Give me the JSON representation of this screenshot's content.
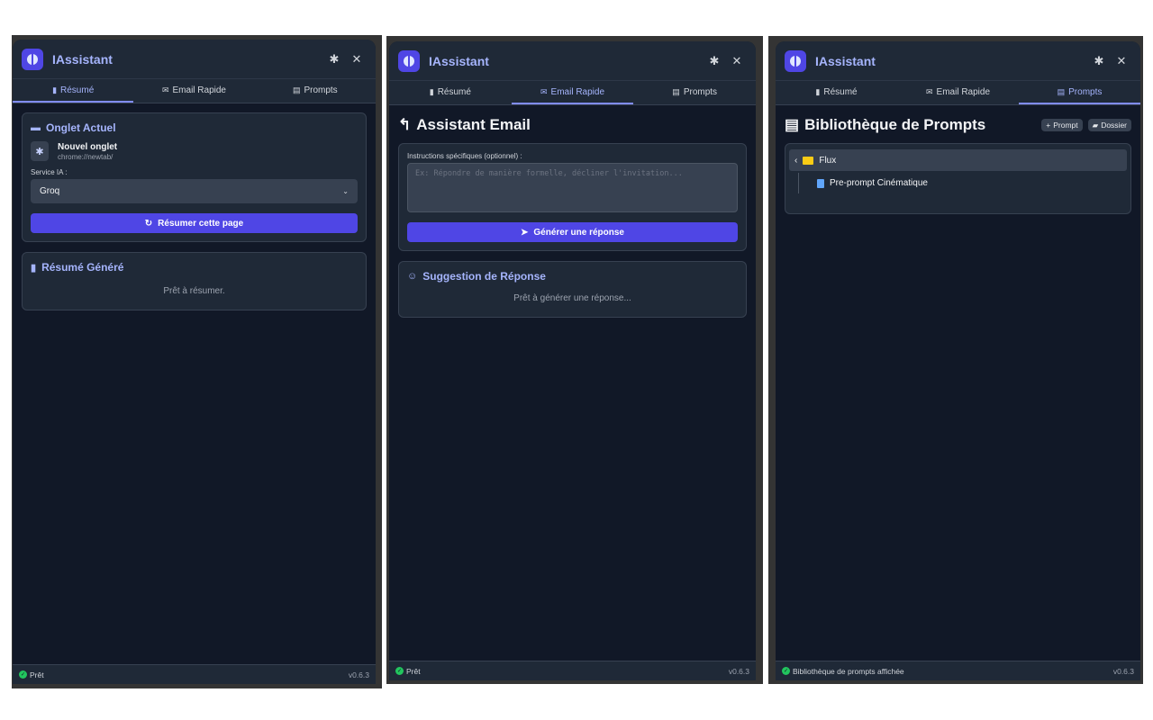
{
  "colors": {
    "accent": "#4f46e5",
    "accent_text": "#a5b4fc",
    "panel_bg": "#111827",
    "card_bg": "#1f2937",
    "status_ok": "#22c55e",
    "folder": "#facc15"
  },
  "common": {
    "app_title": "IAssistant",
    "icons": {
      "logo": "brain-icon",
      "settings": "gear-icon",
      "close": "close-icon"
    },
    "version": "v0.6.3",
    "tabs": [
      {
        "label": "Résumé",
        "icon": "file-icon"
      },
      {
        "label": "Email Rapide",
        "icon": "envelope-icon"
      },
      {
        "label": "Prompts",
        "icon": "list-icon"
      }
    ]
  },
  "panel1": {
    "current_tab_card": {
      "title": "Onglet Actuel",
      "tab_name": "Nouvel onglet",
      "tab_url": "chrome://newtab/",
      "service_label": "Service IA :",
      "service_value": "Groq",
      "summarize_button": "Résumer cette page"
    },
    "summary_card": {
      "title": "Résumé Généré",
      "placeholder": "Prêt à résumer."
    },
    "status": "Prêt"
  },
  "panel2": {
    "title": "Assistant Email",
    "instructions_label": "Instructions spécifiques (optionnel) :",
    "instructions_placeholder": "Ex: Répondre de manière formelle, décliner l'invitation...",
    "generate_button": "Générer une réponse",
    "suggestion_card": {
      "title": "Suggestion de Réponse",
      "placeholder": "Prêt à générer une réponse..."
    },
    "status": "Prêt"
  },
  "panel3": {
    "title": "Bibliothèque de Prompts",
    "add_prompt_button": "Prompt",
    "add_folder_button": "Dossier",
    "tree": {
      "folder": "Flux",
      "items": [
        "Pre-prompt Cinématique"
      ]
    },
    "status": "Bibliothèque de prompts affichée"
  }
}
